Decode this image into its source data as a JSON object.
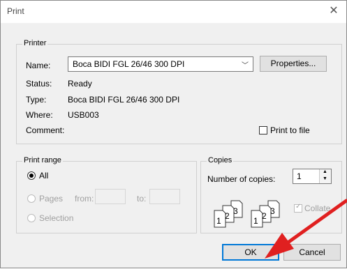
{
  "window": {
    "title": "Print"
  },
  "printer": {
    "group_label": "Printer",
    "name_label": "Name:",
    "name_value": "Boca BIDI FGL 26/46 300 DPI",
    "properties_label": "Properties...",
    "status_label": "Status:",
    "status_value": "Ready",
    "type_label": "Type:",
    "type_value": "Boca BIDI FGL 26/46 300 DPI",
    "where_label": "Where:",
    "where_value": "USB003",
    "comment_label": "Comment:",
    "print_to_file_label": "Print to file"
  },
  "print_range": {
    "group_label": "Print range",
    "all_label": "All",
    "pages_label": "Pages",
    "from_label": "from:",
    "to_label": "to:",
    "selection_label": "Selection"
  },
  "copies": {
    "group_label": "Copies",
    "number_label": "Number of copies:",
    "number_value": "1",
    "collate_label": "Collate",
    "stack_digits": [
      "1",
      "2",
      "3"
    ]
  },
  "buttons": {
    "ok": "OK",
    "cancel": "Cancel"
  },
  "annotation": {
    "arrow_color": "#e02020"
  }
}
